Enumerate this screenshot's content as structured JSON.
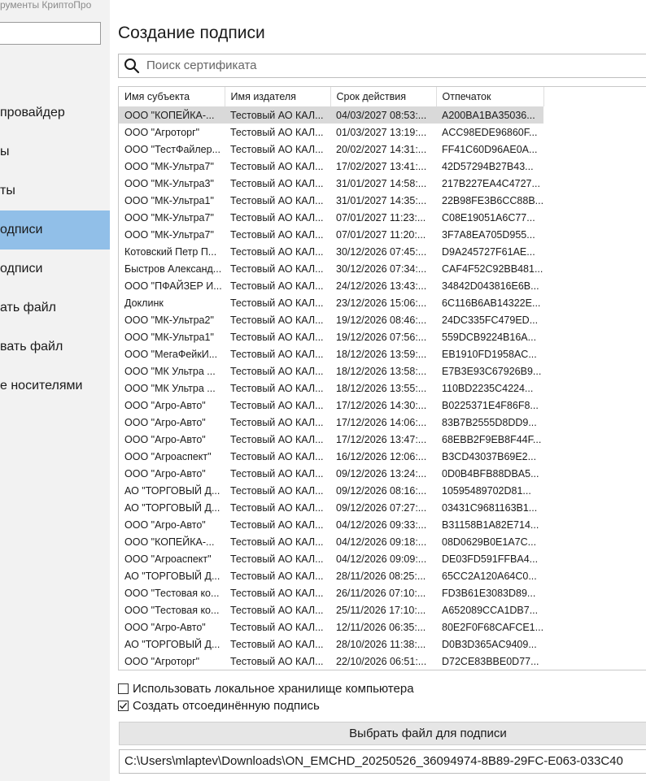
{
  "app": {
    "title": "рументы КриптоПро"
  },
  "sidebar": {
    "items": [
      {
        "label": "провайдер",
        "active": false
      },
      {
        "label": "ы",
        "active": false
      },
      {
        "label": "ты",
        "active": false
      },
      {
        "label": "одписи",
        "active": true
      },
      {
        "label": "одписи",
        "active": false
      },
      {
        "label": "ать файл",
        "active": false
      },
      {
        "label": "вать файл",
        "active": false
      },
      {
        "label": "е носителями",
        "active": false
      }
    ]
  },
  "main": {
    "title": "Создание подписи",
    "search": {
      "placeholder": "Поиск сертификата",
      "icon": "search-icon"
    },
    "table": {
      "columns": [
        "Имя субъекта",
        "Имя издателя",
        "Срок действия",
        "Отпечаток"
      ],
      "rows": [
        [
          "ООО \"КОПЕЙКА-...",
          "Тестовый АО КАЛ...",
          "04/03/2027 08:53:...",
          "A200BA1BA35036..."
        ],
        [
          "ООО \"Агроторг\"",
          "Тестовый АО КАЛ...",
          "01/03/2027 13:19:...",
          "ACC98EDE96860F..."
        ],
        [
          "ООО \"ТестФайлер...",
          "Тестовый АО КАЛ...",
          "20/02/2027 14:31:...",
          "FF41C60D96AE0A..."
        ],
        [
          "ООО \"МК-Ультра7\"",
          "Тестовый АО КАЛ...",
          "17/02/2027 13:41:...",
          "42D57294B27B43..."
        ],
        [
          "ООО \"МК-Ультра3\"",
          "Тестовый АО КАЛ...",
          "31/01/2027 14:58:...",
          "217B227EA4C4727..."
        ],
        [
          "ООО \"МК-Ультра1\"",
          "Тестовый АО КАЛ...",
          "31/01/2027 14:35:...",
          "22B98FE3B6CC88B..."
        ],
        [
          "ООО \"МК-Ультра7\"",
          "Тестовый АО КАЛ...",
          "07/01/2027 11:23:...",
          "C08E19051A6C77..."
        ],
        [
          "ООО \"МК-Ультра7\"",
          "Тестовый АО КАЛ...",
          "07/01/2027 11:20:...",
          "3F7A8EA705D955..."
        ],
        [
          "Котовский Петр П...",
          "Тестовый АО КАЛ...",
          "30/12/2026 07:45:...",
          "D9A245727F61AE..."
        ],
        [
          "Быстров Александ...",
          "Тестовый АО КАЛ...",
          "30/12/2026 07:34:...",
          "CAF4F52C92BB481..."
        ],
        [
          "ООО \"ПФАЙЗЕР И...",
          "Тестовый АО КАЛ...",
          "24/12/2026 13:43:...",
          "34842D043816E6B..."
        ],
        [
          "Доклинк",
          "Тестовый АО КАЛ...",
          "23/12/2026 15:06:...",
          "6C116B6AB14322E..."
        ],
        [
          "ООО \"МК-Ультра2\"",
          "Тестовый АО КАЛ...",
          "19/12/2026 08:46:...",
          "24DC335FC479ED..."
        ],
        [
          "ООО \"МК-Ультра1\"",
          "Тестовый АО КАЛ...",
          "19/12/2026 07:56:...",
          "559DCB9224B16A..."
        ],
        [
          "ООО \"МегаФейкИ...",
          "Тестовый АО КАЛ...",
          "18/12/2026 13:59:...",
          "EB1910FD1958AC..."
        ],
        [
          "ООО \"МК Ультра ...",
          "Тестовый АО КАЛ...",
          "18/12/2026 13:58:...",
          "E7B3E93C67926B9..."
        ],
        [
          "ООО \"МК Ультра ...",
          "Тестовый АО КАЛ...",
          "18/12/2026 13:55:...",
          "110BD2235C4224..."
        ],
        [
          "ООО \"Агро-Авто\"",
          "Тестовый АО КАЛ...",
          "17/12/2026 14:30:...",
          "B0225371E4F86F8..."
        ],
        [
          "ООО \"Агро-Авто\"",
          "Тестовый АО КАЛ...",
          "17/12/2026 14:06:...",
          "83B7B2555D8DD9..."
        ],
        [
          "ООО \"Агро-Авто\"",
          "Тестовый АО КАЛ...",
          "17/12/2026 13:47:...",
          "68EBB2F9EB8F44F..."
        ],
        [
          "ООО \"Агроаспект\"",
          "Тестовый АО КАЛ...",
          "16/12/2026 12:06:...",
          "B3CD43037B69E2..."
        ],
        [
          "ООО \"Агро-Авто\"",
          "Тестовый АО КАЛ...",
          "09/12/2026 13:24:...",
          "0D0B4BFB88DBA5..."
        ],
        [
          "АО \"ТОРГОВЫЙ Д...",
          "Тестовый АО КАЛ...",
          "09/12/2026 08:16:...",
          "10595489702D81..."
        ],
        [
          "АО \"ТОРГОВЫЙ Д...",
          "Тестовый АО КАЛ...",
          "09/12/2026 07:27:...",
          "03431C9681163B1..."
        ],
        [
          "ООО \"Агро-Авто\"",
          "Тестовый АО КАЛ...",
          "04/12/2026 09:33:...",
          "B31158B1A82E714..."
        ],
        [
          "ООО \"КОПЕЙКА-...",
          "Тестовый АО КАЛ...",
          "04/12/2026 09:18:...",
          "08D0629B0E1A7C..."
        ],
        [
          "ООО \"Агроаспект\"",
          "Тестовый АО КАЛ...",
          "04/12/2026 09:09:...",
          "DE03FD591FFBA4..."
        ],
        [
          "АО \"ТОРГОВЫЙ Д...",
          "Тестовый АО КАЛ...",
          "28/11/2026 08:25:...",
          "65CC2A120A64C0..."
        ],
        [
          "ООО \"Тестовая ко...",
          "Тестовый АО КАЛ...",
          "26/11/2026 07:10:...",
          "FD3B61E3083D89..."
        ],
        [
          "ООО \"Тестовая ко...",
          "Тестовый АО КАЛ...",
          "25/11/2026 17:10:...",
          "A652089CCA1DB7..."
        ],
        [
          "ООО \"Агро-Авто\"",
          "Тестовый АО КАЛ...",
          "12/11/2026 06:35:...",
          "80E2F0F68CAFCE1..."
        ],
        [
          "АО \"ТОРГОВЫЙ Д...",
          "Тестовый АО КАЛ...",
          "28/10/2026 11:38:...",
          "D0B3D365AC9409..."
        ],
        [
          "ООО \"Агроторг\"",
          "Тестовый АО КАЛ...",
          "22/10/2026 06:51:...",
          "D72CE83BBE0D77..."
        ]
      ],
      "selected_index": 0
    },
    "options": {
      "local_store": {
        "label": "Использовать локальное хранилище компьютера",
        "checked": false
      },
      "detached": {
        "label": "Создать отсоединённую подпись",
        "checked": true
      }
    },
    "select_button": {
      "label": "Выбрать файл для подписи"
    },
    "file_path": {
      "value": "C:\\Users\\mlaptev\\Downloads\\ON_EMCHD_20250526_36094974-8B89-29FC-E063-033C40"
    }
  },
  "colors": {
    "sidebar_bg": "#f2f2f2",
    "nav_active": "#91bfe8",
    "row_selected": "#d9d9d9",
    "button_bg": "#e6e6e6"
  }
}
